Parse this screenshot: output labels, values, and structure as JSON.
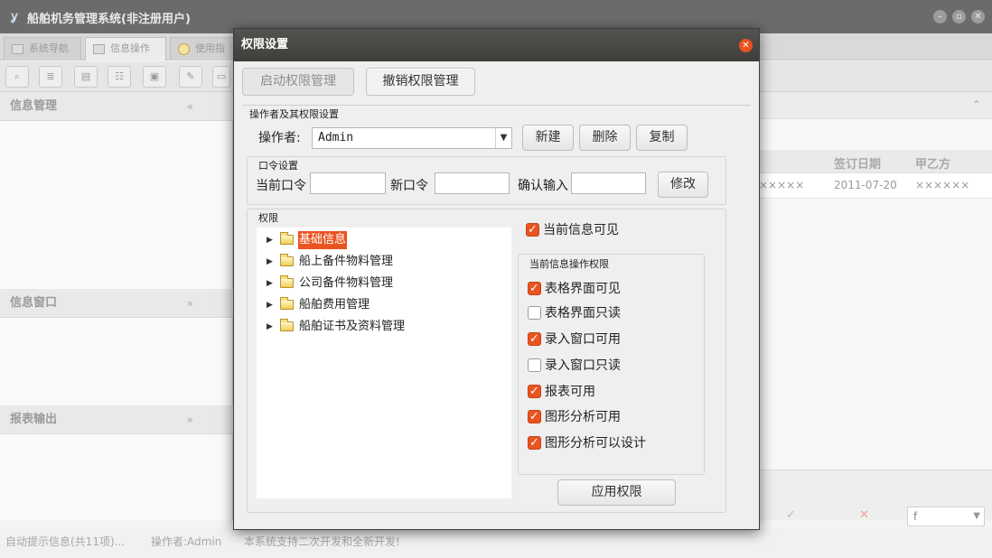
{
  "main": {
    "title": "船舶机务管理系统(非注册用户)",
    "app_icon": "ship-logo-icon",
    "tabs": [
      {
        "label": "系统导航",
        "icon": "monitor-icon"
      },
      {
        "label": "信息操作",
        "icon": "grid-icon"
      },
      {
        "label": "使用指",
        "icon": "help-circle-icon"
      }
    ],
    "panels": {
      "info_manage": "信息管理",
      "info_window": "信息窗口",
      "report_output": "报表输出"
    },
    "collapse_glyph": "«",
    "expand_glyph": "»",
    "up_glyph": "⌃",
    "grid": {
      "columns": [
        "签订日期",
        "甲乙方"
      ],
      "row": {
        "col0": "×××××",
        "date": "2011-07-20",
        "party": "××××××"
      }
    },
    "bottom_combo": "f",
    "bottom_ok": "✓",
    "bottom_cancel": "✕",
    "status": {
      "hint": "自动提示信息(共11项)...",
      "operator": "操作者:Admin",
      "message": "本系统支持二次开发和全新开发!"
    }
  },
  "dialog": {
    "title": "权限设置",
    "tab_enable": "启动权限管理",
    "tab_revoke": "撤销权限管理",
    "operator_section": "操作者及其权限设置",
    "operator_label": "操作者:",
    "operator_value": "Admin",
    "btn_new": "新建",
    "btn_delete": "删除",
    "btn_copy": "复制",
    "password_section": "口令设置",
    "current_pw_label": "当前口令",
    "new_pw_label": "新口令",
    "confirm_pw_label": "确认输入",
    "btn_modify": "修改",
    "permission_section": "权限",
    "tree": [
      {
        "label": "基础信息",
        "selected": true
      },
      {
        "label": "船上备件物料管理",
        "selected": false
      },
      {
        "label": "公司备件物料管理",
        "selected": false
      },
      {
        "label": "船舶费用管理",
        "selected": false
      },
      {
        "label": "船舶证书及资料管理",
        "selected": false
      }
    ],
    "visible_label": "当前信息可见",
    "visible_checked": true,
    "ops_section": "当前信息操作权限",
    "checks": [
      {
        "label": "表格界面可见",
        "checked": true
      },
      {
        "label": "表格界面只读",
        "checked": false
      },
      {
        "label": "录入窗口可用",
        "checked": true
      },
      {
        "label": "录入窗口只读",
        "checked": false
      },
      {
        "label": "报表可用",
        "checked": true
      },
      {
        "label": "图形分析可用",
        "checked": true
      },
      {
        "label": "图形分析可以设计",
        "checked": true
      }
    ],
    "btn_apply": "应用权限"
  },
  "colors": {
    "accent": "#e95420",
    "titlebar": "#45433f"
  }
}
